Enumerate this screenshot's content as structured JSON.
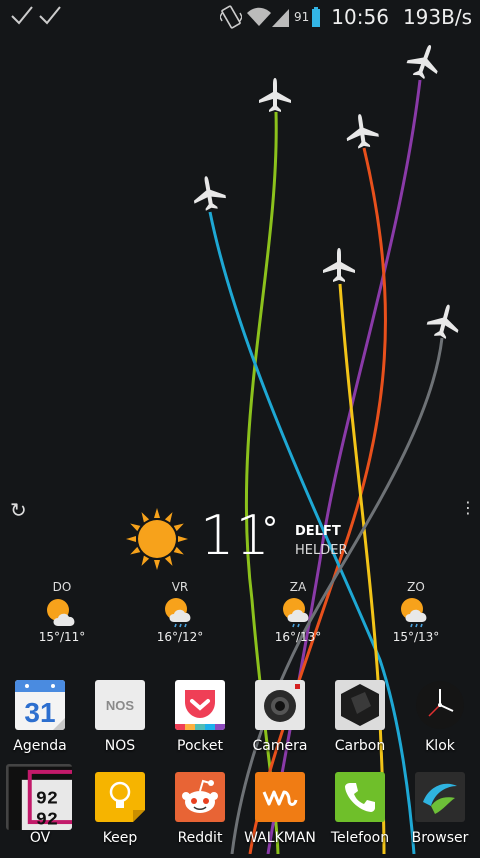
{
  "status_bar": {
    "battery_percent": "91",
    "time": "10:56",
    "data_rate": "193B/s"
  },
  "weather": {
    "temperature": "11",
    "degree_symbol": "°",
    "city": "DELFT",
    "condition": "HELDER",
    "forecast": [
      {
        "day": "DO",
        "temps": "15°/11°"
      },
      {
        "day": "VR",
        "temps": "16°/12°"
      },
      {
        "day": "ZA",
        "temps": "16°/13°"
      },
      {
        "day": "ZO",
        "temps": "15°/13°"
      }
    ]
  },
  "apps_row1": [
    {
      "label": "Agenda",
      "icon": "calendar-icon",
      "text": "31"
    },
    {
      "label": "NOS",
      "icon": "nos-icon",
      "text": "NOS"
    },
    {
      "label": "Pocket",
      "icon": "pocket-icon"
    },
    {
      "label": "Camera",
      "icon": "camera-icon"
    },
    {
      "label": "Carbon",
      "icon": "carbon-icon"
    },
    {
      "label": "Klok",
      "icon": "clock-icon"
    }
  ],
  "apps_row2": [
    {
      "label": "OV",
      "icon": "ov-icon",
      "text": "92 92"
    },
    {
      "label": "Keep",
      "icon": "keep-icon"
    },
    {
      "label": "Reddit",
      "icon": "reddit-icon"
    },
    {
      "label": "WALKMAN",
      "icon": "walkman-icon"
    },
    {
      "label": "Telefoon",
      "icon": "phone-icon"
    },
    {
      "label": "Browser",
      "icon": "browser-icon"
    }
  ],
  "colors": {
    "background": "#141618",
    "trail_green": "#8cc21c",
    "trail_blue": "#1ea8d4",
    "trail_orange": "#e8501c",
    "trail_purple": "#8a3aa8",
    "trail_yellow": "#f2c418",
    "trail_gray": "#6e7276"
  }
}
